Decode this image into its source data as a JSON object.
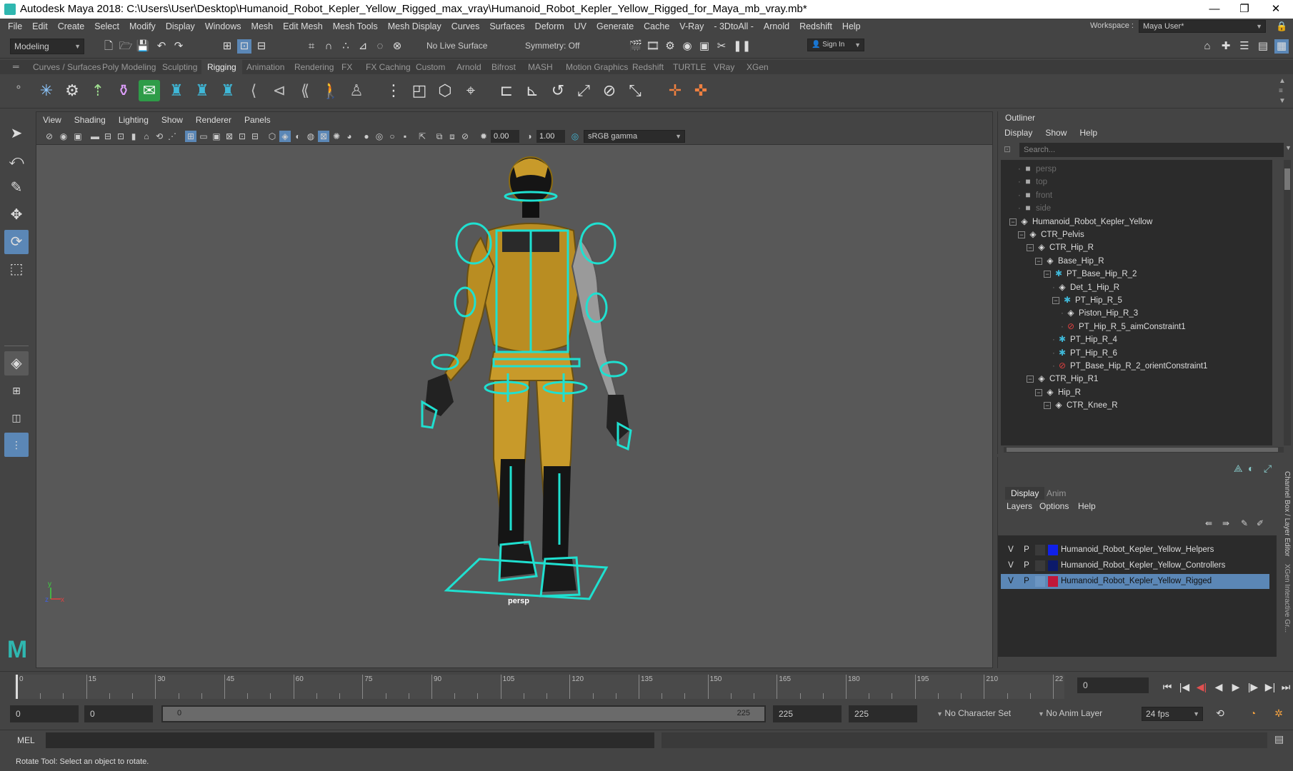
{
  "window": {
    "title": "Autodesk Maya 2018: C:\\Users\\User\\Desktop\\Humanoid_Robot_Kepler_Yellow_Rigged_max_vray\\Humanoid_Robot_Kepler_Yellow_Rigged_for_Maya_mb_vray.mb*",
    "minimize": "—",
    "maximize": "❐",
    "close": "✕"
  },
  "menubar": {
    "items": [
      "File",
      "Edit",
      "Create",
      "Select",
      "Modify",
      "Display",
      "Windows",
      "Mesh",
      "Edit Mesh",
      "Mesh Tools",
      "Mesh Display",
      "Curves",
      "Surfaces",
      "Deform",
      "UV",
      "Generate",
      "Cache",
      "V-Ray",
      "- 3DtoAll -",
      "Arnold",
      "Redshift",
      "Help"
    ],
    "workspace_label": "Workspace :",
    "workspace_value": "Maya User*"
  },
  "statusline": {
    "mode": "Modeling",
    "live_surface": "No Live Surface",
    "symmetry": "Symmetry: Off",
    "signin": "Sign In"
  },
  "shelf": {
    "tabs": [
      "Curves / Surfaces",
      "Poly Modeling",
      "Sculpting",
      "Rigging",
      "Animation",
      "Rendering",
      "FX",
      "FX Caching",
      "Custom",
      "Arnold",
      "Bifrost",
      "MASH",
      "Motion Graphics",
      "Redshift",
      "TURTLE",
      "VRay",
      "XGen"
    ],
    "active_tab": "Rigging"
  },
  "viewport": {
    "menu": [
      "View",
      "Shading",
      "Lighting",
      "Show",
      "Renderer",
      "Panels"
    ],
    "exposure": "0.00",
    "gamma": "1.00",
    "colorspace": "sRGB gamma",
    "camera_label": "persp",
    "axis_y": "y",
    "axis_z": "z",
    "axis_x": "x"
  },
  "outliner": {
    "title": "Outliner",
    "menu": [
      "Display",
      "Show",
      "Help"
    ],
    "search_placeholder": "Search...",
    "rows": [
      {
        "label": "persp",
        "type": "camera",
        "dim": true
      },
      {
        "label": "top",
        "type": "camera",
        "dim": true
      },
      {
        "label": "front",
        "type": "camera",
        "dim": true
      },
      {
        "label": "side",
        "type": "camera",
        "dim": true
      },
      {
        "label": "Humanoid_Robot_Kepler_Yellow",
        "type": "group",
        "expander": "−"
      },
      {
        "label": "CTR_Pelvis",
        "type": "group",
        "expander": "−"
      },
      {
        "label": "CTR_Hip_R",
        "type": "group",
        "expander": "−"
      },
      {
        "label": "Base_Hip_R",
        "type": "group",
        "expander": "−"
      },
      {
        "label": "PT_Base_Hip_R_2",
        "type": "point",
        "expander": "−"
      },
      {
        "label": "Det_1_Hip_R",
        "type": "group",
        "expander": ""
      },
      {
        "label": "PT_Hip_R_5",
        "type": "point",
        "expander": "−"
      },
      {
        "label": "Piston_Hip_R_3",
        "type": "group",
        "expander": ""
      },
      {
        "label": "PT_Hip_R_5_aimConstraint1",
        "type": "constraint",
        "expander": ""
      },
      {
        "label": "PT_Hip_R_4",
        "type": "point",
        "expander": ""
      },
      {
        "label": "PT_Hip_R_6",
        "type": "point",
        "expander": ""
      },
      {
        "label": "PT_Base_Hip_R_2_orientConstraint1",
        "type": "constraint",
        "expander": ""
      },
      {
        "label": "CTR_Hip_R1",
        "type": "group",
        "expander": "−"
      },
      {
        "label": "Hip_R",
        "type": "group",
        "expander": "−"
      },
      {
        "label": "CTR_Knee_R",
        "type": "group",
        "expander": "−"
      }
    ]
  },
  "layers": {
    "tabs": [
      "Display",
      "Anim"
    ],
    "active_tab": "Display",
    "menu": [
      "Layers",
      "Options",
      "Help"
    ],
    "side_label_1": "Channel Box / Layer Editor",
    "side_label_2": "XGen Interactive Gr...",
    "rows": [
      {
        "v": "V",
        "p": "P",
        "name": "Humanoid_Robot_Kepler_Yellow_Helpers",
        "color": "#1020e8",
        "selected": false
      },
      {
        "v": "V",
        "p": "P",
        "name": "Humanoid_Robot_Kepler_Yellow_Controllers",
        "color": "#0c1a6a",
        "selected": false
      },
      {
        "v": "V",
        "p": "P",
        "name": "Humanoid_Robot_Kepler_Yellow_Rigged",
        "color": "#c0183a",
        "selected": true
      }
    ]
  },
  "timeline": {
    "ticks": [
      "0",
      "15",
      "30",
      "45",
      "60",
      "75",
      "90",
      "105",
      "120",
      "135",
      "150",
      "165",
      "180",
      "195",
      "210",
      "22"
    ],
    "current_frame": "0"
  },
  "range": {
    "start": "0",
    "playback_start": "0",
    "slider_start": "0",
    "slider_end": "225",
    "playback_end": "225",
    "end": "225",
    "character_set": "No Character Set",
    "anim_layer": "No Anim Layer",
    "fps": "24 fps"
  },
  "mel": {
    "label": "MEL"
  },
  "helpline": {
    "text": "Rotate Tool: Select an object to rotate."
  },
  "colors": {
    "accent": "#5b87b6",
    "rig_cyan": "#1fe0d0",
    "robot_gold": "#c89a2a"
  }
}
